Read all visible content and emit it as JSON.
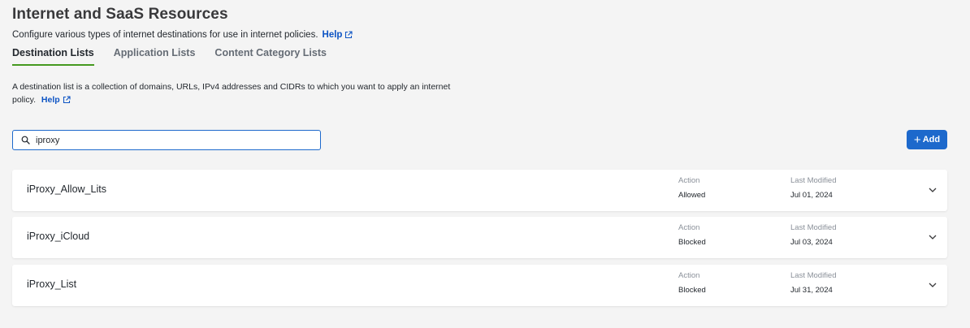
{
  "header": {
    "title": "Internet and SaaS Resources",
    "subtitle": "Configure various types of internet destinations for use in internet policies.",
    "help_label": "Help"
  },
  "tabs": [
    {
      "label": "Destination Lists",
      "active": true
    },
    {
      "label": "Application Lists",
      "active": false
    },
    {
      "label": "Content Category Lists",
      "active": false
    }
  ],
  "description": {
    "text": "A destination list is a collection of domains, URLs, IPv4 addresses and CIDRs to which you want to apply an internet policy.",
    "help_label": "Help"
  },
  "search": {
    "value": "iproxy",
    "icon": "search-icon"
  },
  "add_button": {
    "label": "Add",
    "icon": "plus-icon"
  },
  "list": {
    "action_label": "Action",
    "modified_label": "Last Modified",
    "items": [
      {
        "name": "iProxy_Allow_Lits",
        "action": "Allowed",
        "modified": "Jul 01, 2024"
      },
      {
        "name": "iProxy_iCloud",
        "action": "Blocked",
        "modified": "Jul 03, 2024"
      },
      {
        "name": "iProxy_List",
        "action": "Blocked",
        "modified": "Jul 31, 2024"
      }
    ]
  },
  "colors": {
    "accent": "#1d69cc",
    "tab_underline": "#45991f",
    "link": "#0d54c4",
    "background": "#f4f4f4"
  }
}
